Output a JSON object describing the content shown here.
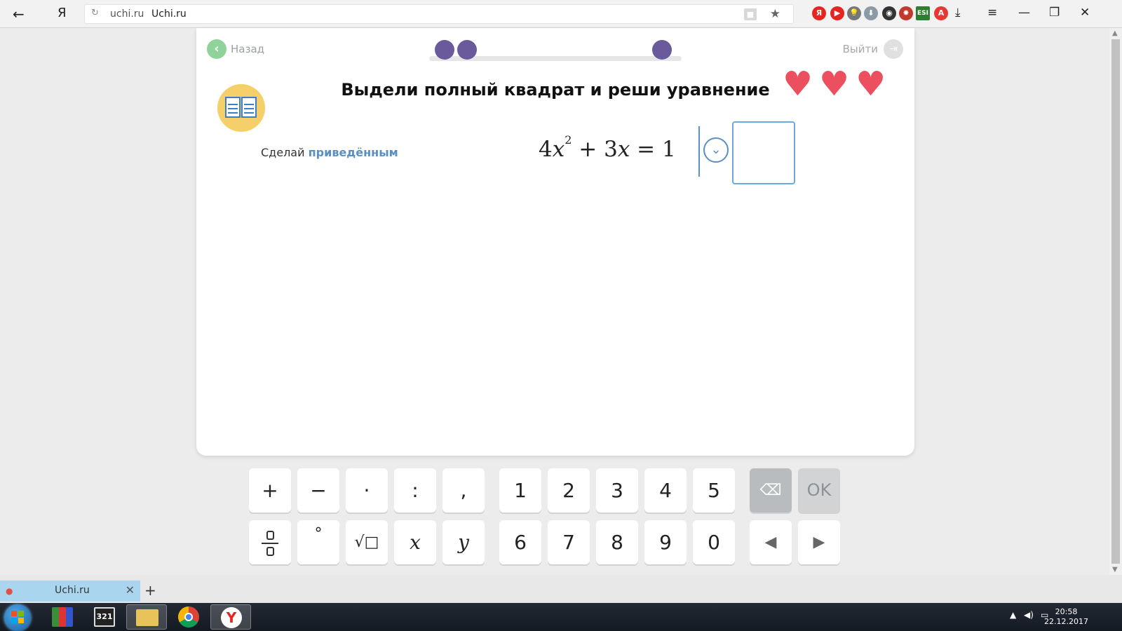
{
  "browser": {
    "back_glyph": "←",
    "logo": "Я",
    "reload_glyph": "↻",
    "domain": "uchi.ru",
    "page_title": "Uchi.ru",
    "bookmark_glyph": "★",
    "extensions": [
      {
        "name": "yandex-icon",
        "label": "Я",
        "color": "#e52620"
      },
      {
        "name": "youtube-icon",
        "label": "▶",
        "color": "#e52620"
      },
      {
        "name": "lightbulb-icon",
        "label": "💡",
        "color": "#777777"
      },
      {
        "name": "download-arrow-icon",
        "label": "⬇",
        "color": "#8c9aa6"
      },
      {
        "name": "map-pin-icon",
        "label": "◉",
        "color": "#333333"
      },
      {
        "name": "bug-icon",
        "label": "✸",
        "color": "#c0392b"
      },
      {
        "name": "esi-icon",
        "label": "ESI",
        "color": "#2e7d32"
      },
      {
        "name": "adblock-icon",
        "label": "A",
        "color": "#e53935"
      }
    ],
    "downloads_glyph": "⤓",
    "menu_glyph": "≡",
    "minimize_glyph": "—",
    "restore_glyph": "❐",
    "close_glyph": "✕"
  },
  "lesson": {
    "back_label": "Назад",
    "exit_label": "Выйти",
    "title": "Выдели полный квадрат и реши уравнение",
    "hint_prefix": "Сделай",
    "hint_link": "приведённым",
    "equation": {
      "coef_a": "4",
      "var": "x",
      "exp": "2",
      "op1": " + 3",
      "var2": "x",
      "rhs": " = 1"
    },
    "lives": 3,
    "accent": "#6a5a9c",
    "heart_color": "#ec4f5e"
  },
  "keypad": {
    "row1_ops": [
      "+",
      "−",
      "·",
      ":",
      ","
    ],
    "row1_digits": [
      "1",
      "2",
      "3",
      "4",
      "5"
    ],
    "row2_ops": [
      "fraction",
      "°",
      "√□",
      "x",
      "y"
    ],
    "row2_digits": [
      "6",
      "7",
      "8",
      "9",
      "0"
    ],
    "backspace_glyph": "⌫",
    "ok_label": "OK",
    "left_glyph": "◀",
    "right_glyph": "▶"
  },
  "tabs": [
    {
      "title": "Uchi.ru",
      "close": "✕"
    }
  ],
  "new_tab_glyph": "+",
  "taskbar": {
    "time": "20:58",
    "date": "22.12.2017"
  }
}
